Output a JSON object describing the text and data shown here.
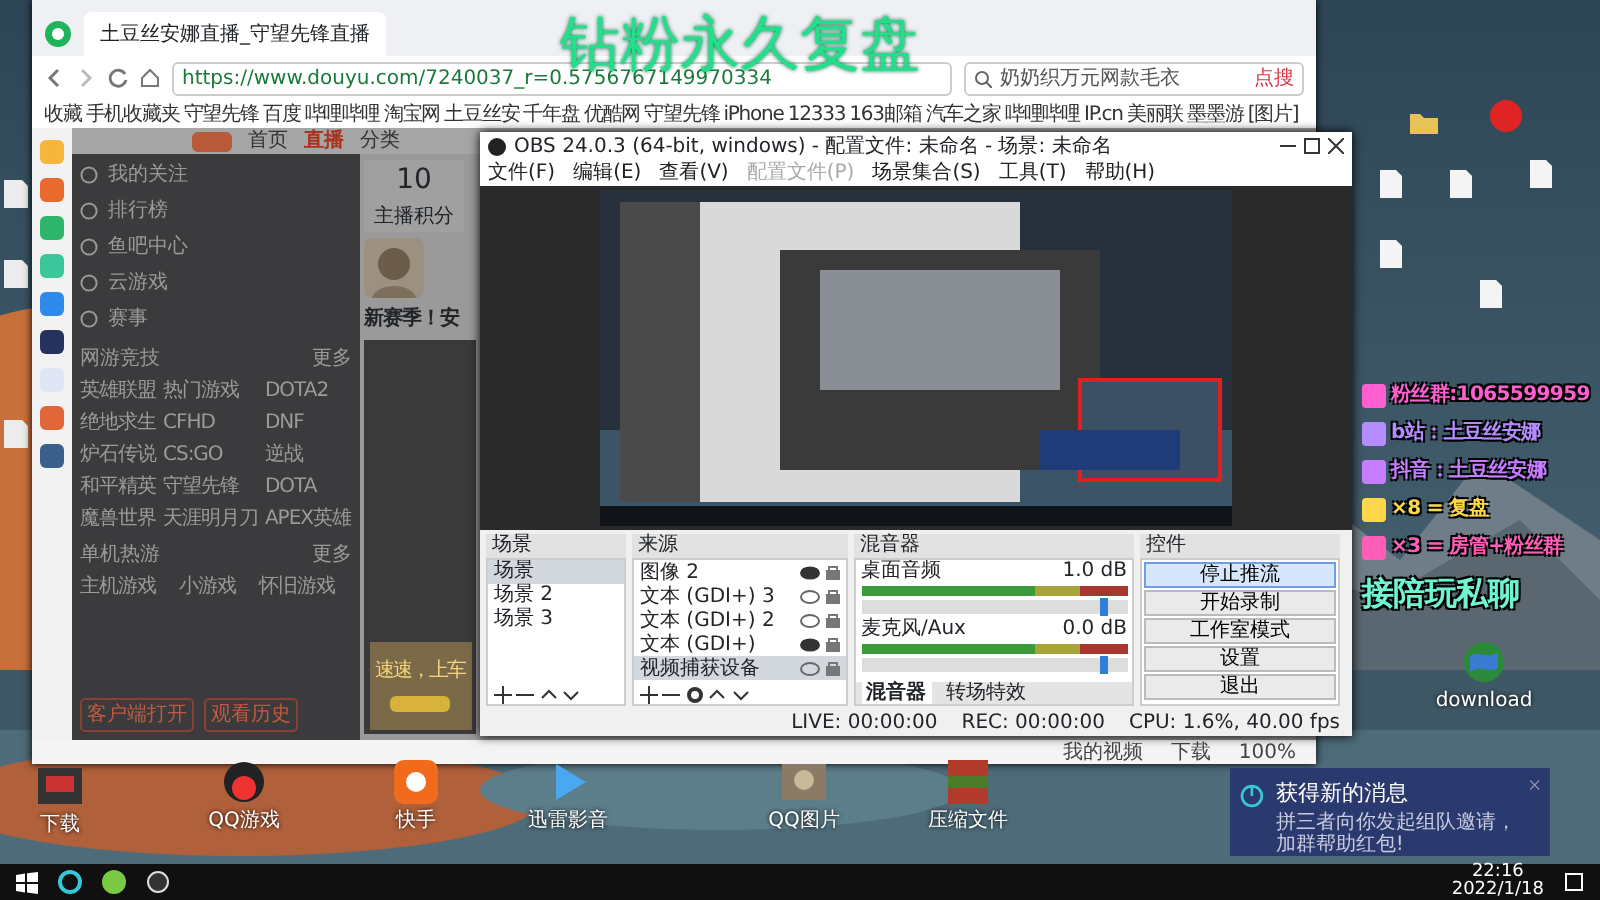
{
  "overlay_title": "钻粉永久复盘",
  "browser": {
    "tab_title": "土豆丝安娜直播_守望先锋直播",
    "url": "https://www.douyu.com/7240037_r=0.5756767149970334",
    "search_text": "奶奶织万元网款毛衣",
    "search_button": "点搜",
    "bookmarks": [
      "收藏",
      "手机收藏夹",
      "守望先锋",
      "百度",
      "哔哩哔哩",
      "淘宝网",
      "土豆丝安",
      "千年盘",
      "优酷网",
      "守望先锋",
      "iPhone",
      "12333",
      "163邮箱",
      "汽车之家",
      "哔哩哔哩",
      "IP.cn",
      "美丽联",
      "墨墨游",
      "[图片]"
    ],
    "page": {
      "nav": [
        {
          "label": "首页",
          "selected": false
        },
        {
          "label": "直播",
          "selected": true
        },
        {
          "label": "分类",
          "selected": false
        }
      ],
      "menu": [
        "我的关注",
        "排行榜",
        "鱼吧中心",
        "云游戏",
        "赛事"
      ],
      "sections": [
        {
          "title": "网游竞技",
          "more": "更多",
          "games": [
            "英雄联盟",
            "热门游戏",
            "DOTA2",
            "绝地求生",
            "CFHD",
            "DNF",
            "炉石传说",
            "CS:GO",
            "逆战",
            "和平精英",
            "守望先锋",
            "DOTA",
            "魔兽世界",
            "天涯明月刀",
            "APEX英雄"
          ]
        },
        {
          "title": "单机热游",
          "more": "更多",
          "games": [
            "主机游戏",
            "小游戏",
            "怀旧游戏"
          ]
        }
      ],
      "side_buttons": [
        "客户端打开",
        "观看历史"
      ],
      "badge": "主播积分",
      "score": "10",
      "card_title": "新赛季！安",
      "promo": "速速，上车"
    },
    "status_items": [
      "我的视频",
      "下载",
      "100%"
    ]
  },
  "obs": {
    "title": "OBS 24.0.3 (64-bit, windows) - 配置文件: 未命名 - 场景: 未命名",
    "menus": [
      {
        "label": "文件(F)",
        "disabled": false
      },
      {
        "label": "编辑(E)",
        "disabled": false
      },
      {
        "label": "查看(V)",
        "disabled": false
      },
      {
        "label": "配置文件(P)",
        "disabled": true
      },
      {
        "label": "场景集合(S)",
        "disabled": false
      },
      {
        "label": "工具(T)",
        "disabled": false
      },
      {
        "label": "帮助(H)",
        "disabled": false
      }
    ],
    "docks": [
      "场景",
      "来源",
      "混音器",
      "控件"
    ],
    "scenes": [
      {
        "label": "场景",
        "selected": true
      },
      {
        "label": "场景 2",
        "selected": false
      },
      {
        "label": "场景 3",
        "selected": false
      }
    ],
    "sources": [
      {
        "label": "图像 2",
        "selected": false,
        "visible": true
      },
      {
        "label": "文本 (GDI+) 3",
        "selected": false,
        "visible": false
      },
      {
        "label": "文本 (GDI+) 2",
        "selected": false,
        "visible": false
      },
      {
        "label": "文本 (GDI+)",
        "selected": false,
        "visible": true
      },
      {
        "label": "视频捕获设备",
        "selected": true,
        "visible": false
      }
    ],
    "mixer": [
      {
        "name": "桌面音频",
        "reading": "1.0 dB",
        "level": 0.93
      },
      {
        "name": "麦克风/Aux",
        "reading": "0.0 dB",
        "level": 0.93
      }
    ],
    "mixer_tabs": [
      {
        "label": "混音器",
        "selected": true
      },
      {
        "label": "转场特效",
        "selected": false
      }
    ],
    "controls": [
      {
        "label": "停止推流",
        "selected": true
      },
      {
        "label": "开始录制",
        "selected": false
      },
      {
        "label": "工作室模式",
        "selected": false
      },
      {
        "label": "设置",
        "selected": false
      },
      {
        "label": "退出",
        "selected": false
      }
    ],
    "status": [
      "LIVE: 00:00:00",
      "REC: 00:00:00",
      "CPU: 1.6%, 40.00 fps"
    ]
  },
  "promo_lines": [
    {
      "text": "粉丝群:1065599959",
      "color": "#ff5fd0"
    },
    {
      "text": "b站：土豆丝安娜",
      "color": "#b58cff"
    },
    {
      "text": "抖音：土豆丝安娜",
      "color": "#c77dff"
    },
    {
      "text": "×8 = 复盘",
      "color": "#ffd84a"
    },
    {
      "text": "×3 = 房管+粉丝群",
      "color": "#ff5fb8"
    },
    {
      "text": "接陪玩私聊",
      "color": "#6ff5d2"
    }
  ],
  "desktop_icons": [
    {
      "label": "下载"
    },
    {
      "label": "QQ游戏"
    },
    {
      "label": "快手"
    },
    {
      "label": "迅雷影音"
    },
    {
      "label": "QQ图片"
    },
    {
      "label": "压缩文件"
    },
    {
      "label": "download"
    }
  ],
  "notification": {
    "title": "获得新的消息",
    "text": "拼三者向你发起组队邀请，加群帮助红包!"
  },
  "taskbar": {
    "time": "22:16",
    "date": "2022/1/18"
  }
}
